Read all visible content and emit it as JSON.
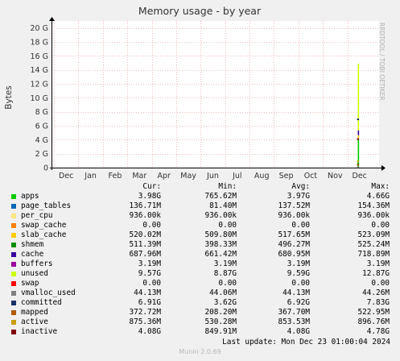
{
  "chart_data": {
    "type": "area",
    "title": "Memory usage - by year",
    "ylabel": "Bytes",
    "watermark": "RRDTOOL / TOBI OETIKER",
    "ylim": [
      0,
      21000000000
    ],
    "yticks": [
      0,
      2000000000,
      4000000000,
      6000000000,
      8000000000,
      10000000000,
      12000000000,
      14000000000,
      16000000000,
      18000000000,
      20000000000
    ],
    "ytick_labels": [
      "0",
      "2 G",
      "4 G",
      "6 G",
      "8 G",
      "10 G",
      "12 G",
      "14 G",
      "16 G",
      "18 G",
      "20 G"
    ],
    "x_labels": [
      "Dec",
      "Jan",
      "Feb",
      "Mar",
      "Apr",
      "May",
      "Jun",
      "Jul",
      "Aug",
      "Sep",
      "Oct",
      "Nov",
      "Dec"
    ],
    "grid": true,
    "x_data_start_month_index": 12.2,
    "series": [
      {
        "name": "apps",
        "color": "#00CC00",
        "value": 3980000000
      },
      {
        "name": "page_tables",
        "color": "#0066B3",
        "value": 136710000
      },
      {
        "name": "per_cpu",
        "color": "#FFE680",
        "value": 936000
      },
      {
        "name": "swap_cache",
        "color": "#FF8000",
        "value": 0
      },
      {
        "name": "slab_cache",
        "color": "#FFCC00",
        "value": 520020000
      },
      {
        "name": "shmem",
        "color": "#008F00",
        "value": 511390000
      },
      {
        "name": "cache",
        "color": "#330099",
        "value": 687960000
      },
      {
        "name": "buffers",
        "color": "#990099",
        "value": 3190000
      },
      {
        "name": "unused",
        "color": "#CCFF00",
        "value": 9570000000
      },
      {
        "name": "swap",
        "color": "#FF0000",
        "value": 0
      },
      {
        "name": "vmalloc_used",
        "color": "#808080",
        "value": 44130000
      },
      {
        "name": "committed",
        "color": "#1A3366",
        "value": 6910000000
      },
      {
        "name": "mapped",
        "color": "#B35A00",
        "value": 372720000
      },
      {
        "name": "active",
        "color": "#C8A000",
        "value": 875360000
      },
      {
        "name": "inactive",
        "color": "#800000",
        "value": 4080000000
      }
    ]
  },
  "legend": {
    "headers": {
      "cur": "Cur:",
      "min": "Min:",
      "avg": "Avg:",
      "max": "Max:"
    },
    "rows": [
      {
        "name": "apps",
        "color": "#00CC00",
        "cur": "3.98G",
        "min": "765.62M",
        "avg": "3.97G",
        "max": "4.66G"
      },
      {
        "name": "page_tables",
        "color": "#0066B3",
        "cur": "136.71M",
        "min": "81.40M",
        "avg": "137.52M",
        "max": "154.36M"
      },
      {
        "name": "per_cpu",
        "color": "#FFE680",
        "cur": "936.00k",
        "min": "936.00k",
        "avg": "936.00k",
        "max": "936.00k"
      },
      {
        "name": "swap_cache",
        "color": "#FF8000",
        "cur": "0.00",
        "min": "0.00",
        "avg": "0.00",
        "max": "0.00"
      },
      {
        "name": "slab_cache",
        "color": "#FFCC00",
        "cur": "520.02M",
        "min": "509.80M",
        "avg": "517.65M",
        "max": "523.09M"
      },
      {
        "name": "shmem",
        "color": "#008F00",
        "cur": "511.39M",
        "min": "398.33M",
        "avg": "496.27M",
        "max": "525.24M"
      },
      {
        "name": "cache",
        "color": "#330099",
        "cur": "687.96M",
        "min": "661.42M",
        "avg": "680.95M",
        "max": "718.89M"
      },
      {
        "name": "buffers",
        "color": "#990099",
        "cur": "3.19M",
        "min": "3.19M",
        "avg": "3.19M",
        "max": "3.19M"
      },
      {
        "name": "unused",
        "color": "#CCFF00",
        "cur": "9.57G",
        "min": "8.87G",
        "avg": "9.59G",
        "max": "12.87G"
      },
      {
        "name": "swap",
        "color": "#FF0000",
        "cur": "0.00",
        "min": "0.00",
        "avg": "0.00",
        "max": "0.00"
      },
      {
        "name": "vmalloc_used",
        "color": "#808080",
        "cur": "44.13M",
        "min": "44.06M",
        "avg": "44.13M",
        "max": "44.26M"
      },
      {
        "name": "committed",
        "color": "#1A3366",
        "cur": "6.91G",
        "min": "3.62G",
        "avg": "6.92G",
        "max": "7.83G"
      },
      {
        "name": "mapped",
        "color": "#B35A00",
        "cur": "372.72M",
        "min": "208.20M",
        "avg": "367.70M",
        "max": "522.95M"
      },
      {
        "name": "active",
        "color": "#C8A000",
        "cur": "875.36M",
        "min": "530.28M",
        "avg": "853.53M",
        "max": "896.76M"
      },
      {
        "name": "inactive",
        "color": "#800000",
        "cur": "4.08G",
        "min": "849.91M",
        "avg": "4.08G",
        "max": "4.78G"
      }
    ]
  },
  "last_update": "Last update: Mon Dec 23 01:00:04 2024",
  "footer": "Munin 2.0.69"
}
